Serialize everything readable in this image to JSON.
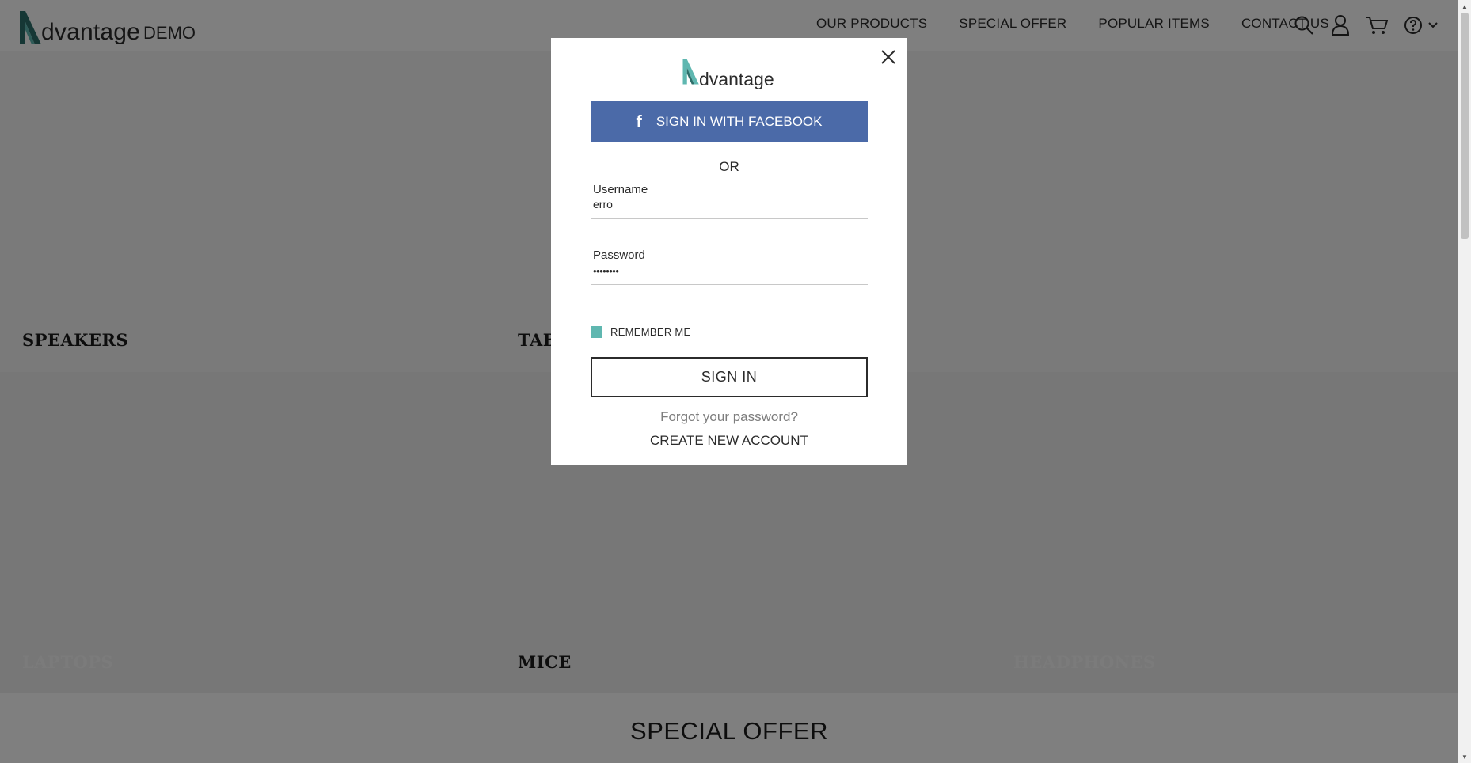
{
  "header": {
    "brand_name": "dvantage",
    "brand_suffix": "DEMO",
    "nav": [
      {
        "label": "OUR PRODUCTS"
      },
      {
        "label": "SPECIAL OFFER"
      },
      {
        "label": "POPULAR ITEMS"
      },
      {
        "label": "CONTACT US"
      }
    ],
    "icons": [
      "search-icon",
      "user-icon",
      "cart-icon",
      "help-icon",
      "chevron-down-icon"
    ]
  },
  "categories": {
    "speakers": "SPEAKERS",
    "tablets": "TABLETS",
    "laptops": "LAPTOPS",
    "mice": "MICE",
    "headphones": "HEADPHONES"
  },
  "special_offer": {
    "title": "SPECIAL OFFER"
  },
  "login_modal": {
    "logo_name": "dvantage",
    "facebook_label": "SIGN IN WITH FACEBOOK",
    "or_text": "OR",
    "username_label": "Username",
    "username_value": "erro",
    "password_label": "Password",
    "password_value": "••••••••",
    "remember_label": "REMEMBER ME",
    "remember_checked": true,
    "signin_label": "SIGN IN",
    "forgot_label": "Forgot your password?",
    "create_account_label": "CREATE NEW ACCOUNT"
  },
  "colors": {
    "brand_teal": "#5fb7b0",
    "facebook_blue": "#4b6aa8",
    "overlay": "rgba(0,0,0,0.5)",
    "text_dark": "#2b2b2b"
  }
}
